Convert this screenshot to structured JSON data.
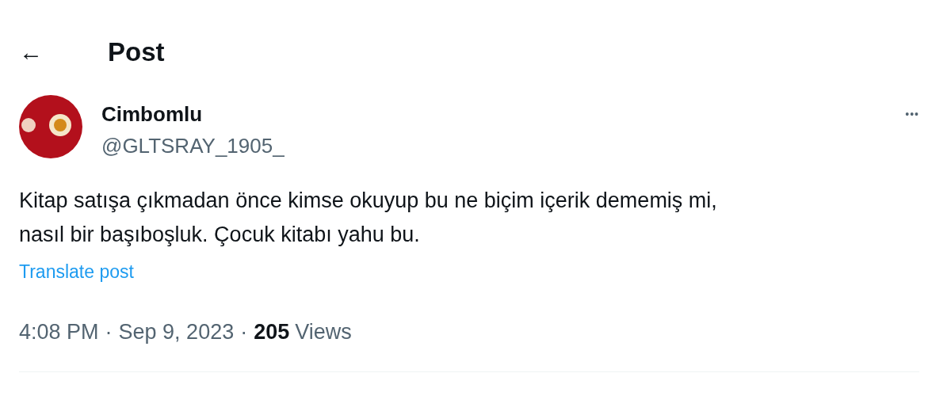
{
  "header": {
    "back": "←",
    "title": "Post"
  },
  "author": {
    "name": "Cimbomlu",
    "handle": "@GLTSRAY_1905_",
    "more": "•••"
  },
  "post": {
    "lines": [
      "Kitap satışa çıkmadan önce kimse okuyup bu ne biçim içerik dememiş mi,",
      "nasıl bir başıboşluk. Çocuk kitabı yahu bu."
    ],
    "translate": "Translate post"
  },
  "meta": {
    "time": "4:08 PM",
    "separator": "·",
    "date": "Sep 9, 2023",
    "views_count": "205",
    "views_label": "Views"
  }
}
